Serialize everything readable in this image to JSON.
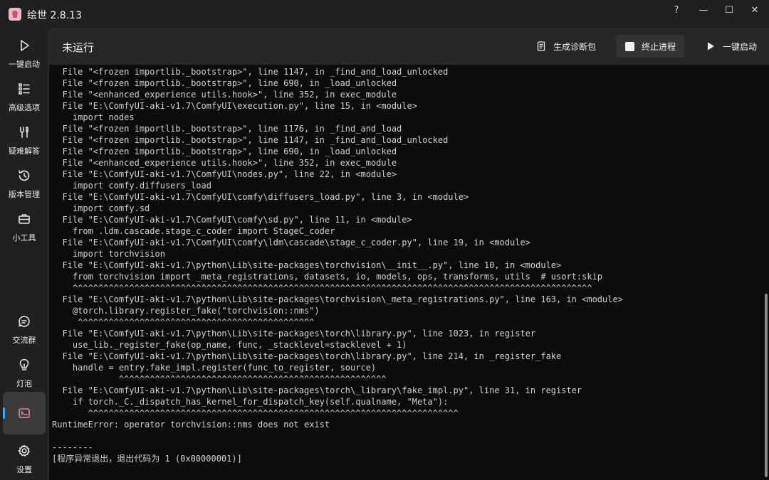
{
  "app": {
    "title": "绘世 2.8.13"
  },
  "window_controls": {
    "help": "?",
    "minimize": "—",
    "maximize": "☐",
    "close": "✕"
  },
  "sidebar": {
    "top_items": [
      {
        "label": "一键启动",
        "icon": "play-icon"
      },
      {
        "label": "高级选项",
        "icon": "list-icon"
      },
      {
        "label": "疑难解答",
        "icon": "tools-icon"
      },
      {
        "label": "版本管理",
        "icon": "history-icon"
      },
      {
        "label": "小工具",
        "icon": "toolbox-icon"
      }
    ],
    "bottom_items": [
      {
        "label": "交流群",
        "icon": "chat-icon"
      },
      {
        "label": "灯泡",
        "icon": "lightbulb-icon"
      },
      {
        "label": "",
        "icon": "console-icon",
        "active": true
      },
      {
        "label": "设置",
        "icon": "gear-icon"
      }
    ]
  },
  "header": {
    "status": "未运行",
    "diag_label": "生成诊断包",
    "stop_label": "终止进程",
    "launch_label": "一键启动"
  },
  "console": {
    "lines": [
      "  File \"<frozen importlib._bootstrap>\", line 1147, in _find_and_load_unlocked",
      "  File \"<frozen importlib._bootstrap>\", line 690, in _load_unlocked",
      "  File \"<enhanced_experience utils.hook>\", line 352, in exec_module",
      "  File \"E:\\ComfyUI-aki-v1.7\\ComfyUI\\execution.py\", line 15, in <module>",
      "    import nodes",
      "  File \"<frozen importlib._bootstrap>\", line 1176, in _find_and_load",
      "  File \"<frozen importlib._bootstrap>\", line 1147, in _find_and_load_unlocked",
      "  File \"<frozen importlib._bootstrap>\", line 690, in _load_unlocked",
      "  File \"<enhanced_experience utils.hook>\", line 352, in exec_module",
      "  File \"E:\\ComfyUI-aki-v1.7\\ComfyUI\\nodes.py\", line 22, in <module>",
      "    import comfy.diffusers_load",
      "  File \"E:\\ComfyUI-aki-v1.7\\ComfyUI\\comfy\\diffusers_load.py\", line 3, in <module>",
      "    import comfy.sd",
      "  File \"E:\\ComfyUI-aki-v1.7\\ComfyUI\\comfy\\sd.py\", line 11, in <module>",
      "    from .ldm.cascade.stage_c_coder import StageC_coder",
      "  File \"E:\\ComfyUI-aki-v1.7\\ComfyUI\\comfy\\ldm\\cascade\\stage_c_coder.py\", line 19, in <module>",
      "    import torchvision",
      "  File \"E:\\ComfyUI-aki-v1.7\\python\\Lib\\site-packages\\torchvision\\__init__.py\", line 10, in <module>",
      "    from torchvision import _meta_registrations, datasets, io, models, ops, transforms, utils  # usort:skip",
      "    ^^^^^^^^^^^^^^^^^^^^^^^^^^^^^^^^^^^^^^^^^^^^^^^^^^^^^^^^^^^^^^^^^^^^^^^^^^^^^^^^^^^^^^^^^^^^^^^^^^^^^",
      "  File \"E:\\ComfyUI-aki-v1.7\\python\\Lib\\site-packages\\torchvision\\_meta_registrations.py\", line 163, in <module>",
      "    @torch.library.register_fake(\"torchvision::nms\")",
      "     ^^^^^^^^^^^^^^^^^^^^^^^^^^^^^^^^^^^^^^^^^^^^^^",
      "  File \"E:\\ComfyUI-aki-v1.7\\python\\Lib\\site-packages\\torch\\library.py\", line 1023, in register",
      "    use_lib._register_fake(op_name, func, _stacklevel=stacklevel + 1)",
      "  File \"E:\\ComfyUI-aki-v1.7\\python\\Lib\\site-packages\\torch\\library.py\", line 214, in _register_fake",
      "    handle = entry.fake_impl.register(func_to_register, source)",
      "             ^^^^^^^^^^^^^^^^^^^^^^^^^^^^^^^^^^^^^^^^^^^^^^^^^^^^",
      "  File \"E:\\ComfyUI-aki-v1.7\\python\\Lib\\site-packages\\torch\\_library\\fake_impl.py\", line 31, in register",
      "    if torch._C._dispatch_has_kernel_for_dispatch_key(self.qualname, \"Meta\"):",
      "       ^^^^^^^^^^^^^^^^^^^^^^^^^^^^^^^^^^^^^^^^^^^^^^^^^^^^^^^^^^^^^^^^^^^^^^^^",
      "RuntimeError: operator torchvision::nms does not exist",
      "",
      "--------",
      "[程序异常退出，退出代码为 1 (0x00000001)]"
    ]
  },
  "colors": {
    "accent": "#4aa8e8",
    "console_bg": "#0c0c0c",
    "panel_bg": "#272727",
    "app_bg": "#202020"
  }
}
